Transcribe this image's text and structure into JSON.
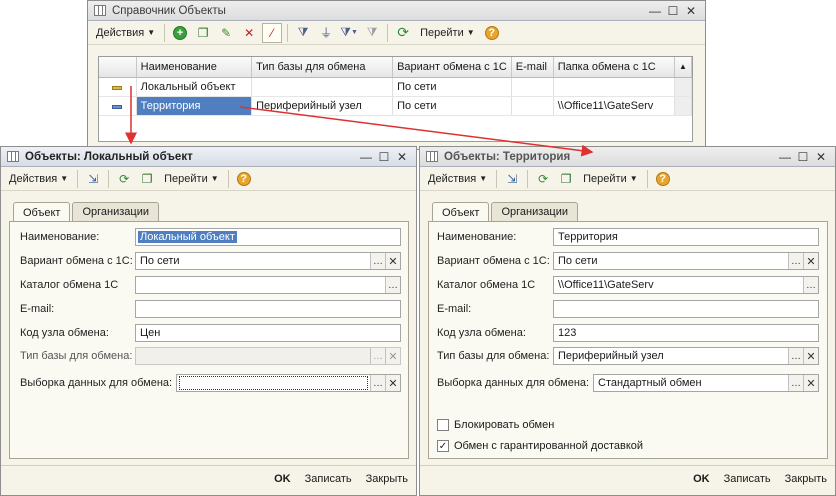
{
  "top": {
    "title": "Справочник Объекты",
    "toolbar": {
      "actions": "Действия",
      "goto": "Перейти"
    },
    "columns": [
      "Наименование",
      "Тип базы для обмена",
      "Вариант обмена с 1С",
      "E-mail",
      "Папка обмена с 1С"
    ],
    "rows": [
      {
        "name": "Локальный объект",
        "type": "",
        "variant": "По сети",
        "email": "",
        "folder": ""
      },
      {
        "name": "Территория",
        "type": "Периферийный узел",
        "variant": "По сети",
        "email": "",
        "folder": "\\\\Office11\\GateServ"
      }
    ]
  },
  "left": {
    "title": "Объекты: Локальный объект",
    "toolbar": {
      "actions": "Действия",
      "goto": "Перейти"
    },
    "tabs": [
      "Объект",
      "Организации"
    ],
    "labels": {
      "name": "Наименование:",
      "variant": "Вариант обмена с 1С:",
      "catalog": "Каталог обмена 1С",
      "email": "E-mail:",
      "code": "Код узла обмена:",
      "type": "Тип базы для обмена:",
      "selection": "Выборка данных для обмена:"
    },
    "values": {
      "name": "Локальный объект",
      "variant": "По сети",
      "catalog": "",
      "email": "",
      "code": "Цен",
      "type": "",
      "selection": ""
    },
    "footer": {
      "ok": "OK",
      "save": "Записать",
      "close": "Закрыть"
    }
  },
  "right": {
    "title": "Объекты: Территория",
    "toolbar": {
      "actions": "Действия",
      "goto": "Перейти"
    },
    "tabs": [
      "Объект",
      "Организации"
    ],
    "labels": {
      "name": "Наименование:",
      "variant": "Вариант обмена с 1С:",
      "catalog": "Каталог обмена 1С",
      "email": "E-mail:",
      "code": "Код узла обмена:",
      "type": "Тип базы для обмена:",
      "selection": "Выборка данных для обмена:"
    },
    "values": {
      "name": "Территория",
      "variant": "По сети",
      "catalog": "\\\\Office11\\GateServ",
      "email": "",
      "code": "123",
      "type": "Периферийный узел",
      "selection": "Стандартный обмен"
    },
    "checkboxes": [
      {
        "label": "Блокировать обмен",
        "checked": false
      },
      {
        "label": "Обмен с гарантированной доставкой",
        "checked": true
      }
    ],
    "footer": {
      "ok": "OK",
      "save": "Записать",
      "close": "Закрыть"
    }
  },
  "colors": {
    "selection": "#4f7fc0",
    "arrow": "#e03030",
    "window_bg": "#f6f4e9"
  }
}
